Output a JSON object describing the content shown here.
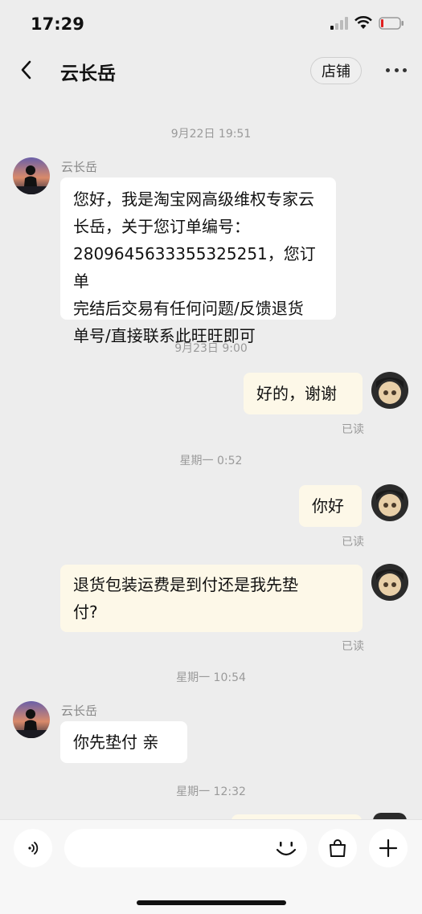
{
  "status_bar": {
    "time": "17:29"
  },
  "header": {
    "title": "云长岳",
    "shop_label": "店铺",
    "back_icon": "chevron-left-icon",
    "more_icon": "ellipsis-icon"
  },
  "chat": {
    "time_1": "9月22日 19:51",
    "msg1_sender": "云长岳",
    "msg1_lines": [
      "您好，我是淘宝网高级维权专家云",
      "长岳，关于您订单编号：",
      "2809645633355325251，您订单",
      "完结后交易有任何问题/反馈退货",
      "单号/直接联系此旺旺即可"
    ],
    "time_2": "9月23日 9:00",
    "msg2_text": "好的，谢谢",
    "msg2_status": "已读",
    "time_3": "星期一 0:52",
    "msg3_text": "你好",
    "msg3_status": "已读",
    "msg4_lines": [
      "退货包装运费是到付还是我先垫",
      "付?"
    ],
    "msg4_status": "已读",
    "time_4": "星期一 10:54",
    "msg5_sender": "云长岳",
    "msg5_text": "你先垫付  亲",
    "time_5": "星期一 12:32"
  },
  "bottom_bar": {
    "voice_icon": "voice-icon",
    "emoji_icon": "emoji-icon",
    "bag_icon": "shopping-bag-icon",
    "plus_icon": "plus-icon"
  },
  "colors": {
    "background": "#ededed",
    "bubble_left": "#ffffff",
    "bubble_right": "#fdf8e8",
    "timestamp": "#9a9a9a"
  }
}
